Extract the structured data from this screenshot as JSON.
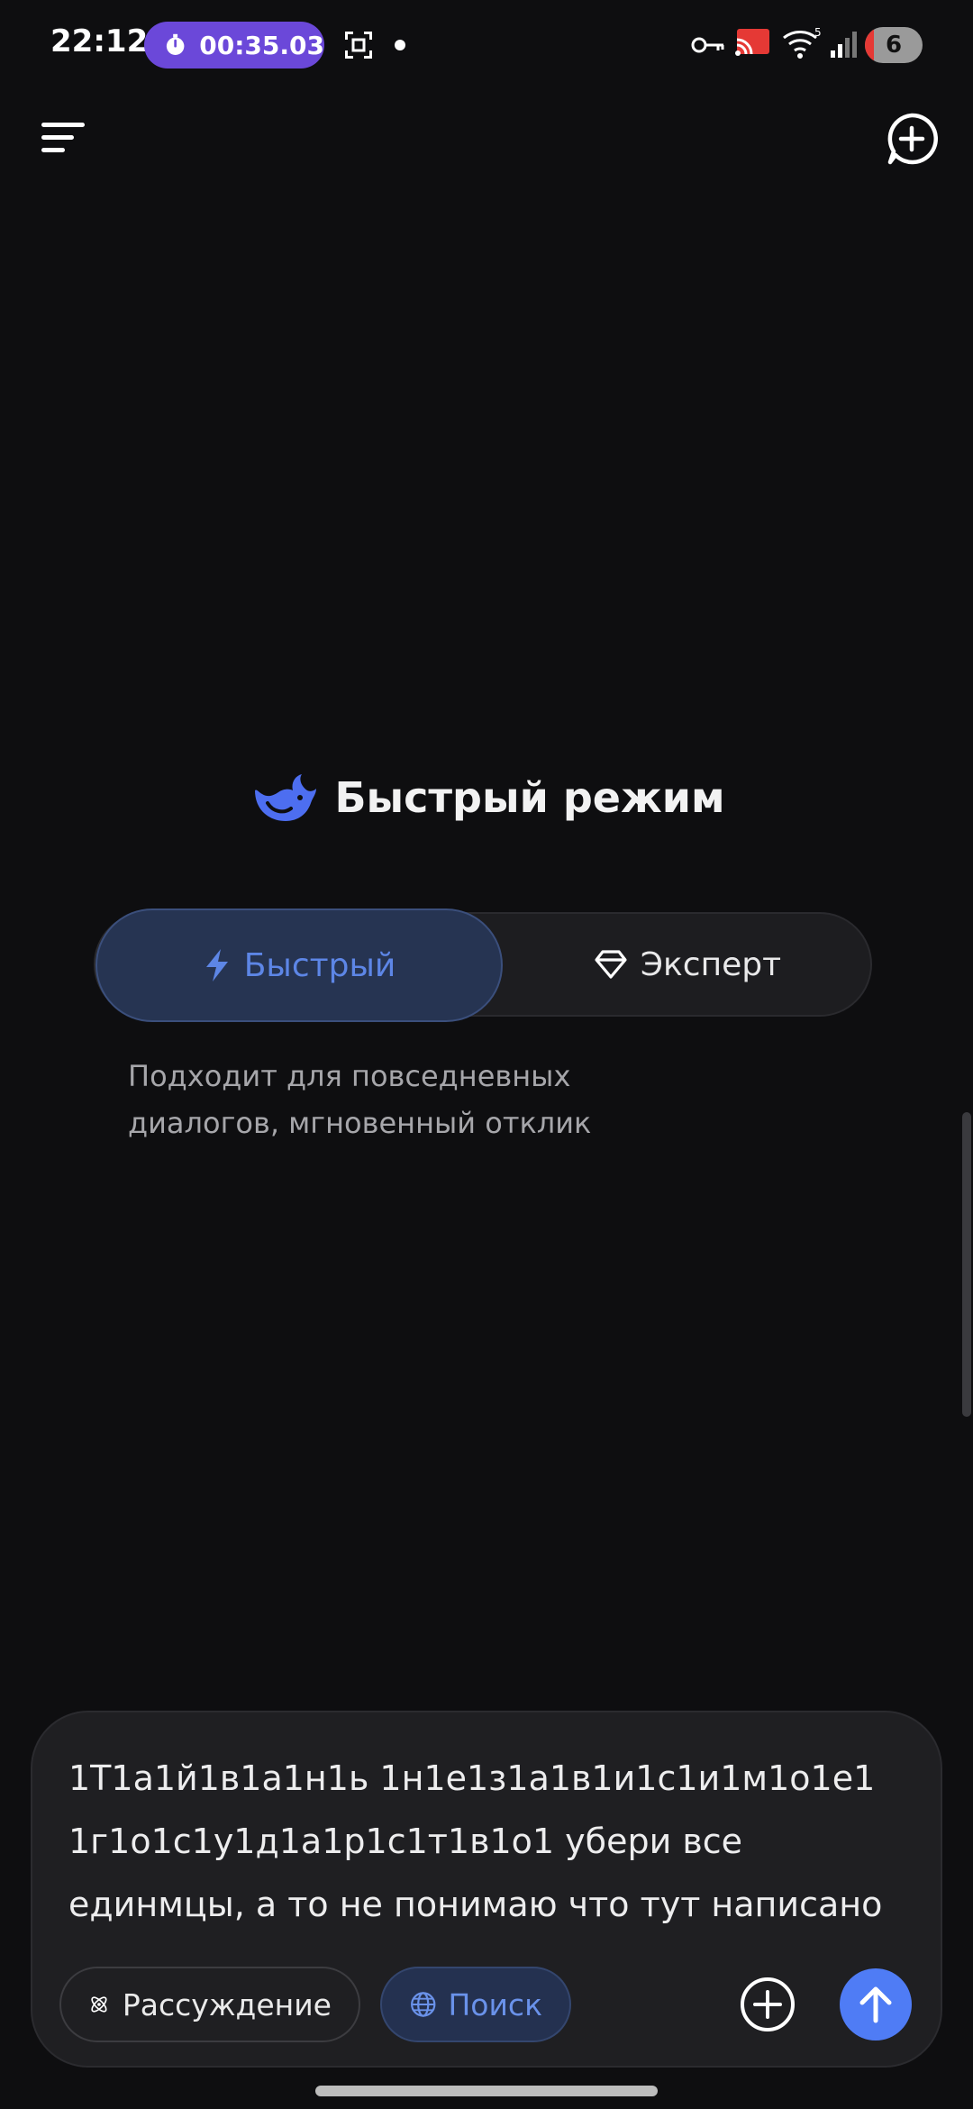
{
  "status_bar": {
    "time": "22:12",
    "timer": "00:35.03",
    "battery_level": "6",
    "icons": [
      "stopwatch-icon",
      "screenshot-icon",
      "dot-icon",
      "key-icon",
      "cast-icon",
      "wifi-icon",
      "signal-icon",
      "battery-icon"
    ]
  },
  "header": {
    "menu_icon": "menu-icon",
    "new_chat_icon": "new-chat-icon"
  },
  "mode": {
    "title": "Быстрый режим",
    "logo": "whale-logo-icon",
    "options": [
      {
        "label": "Быстрый",
        "icon": "lightning-icon",
        "selected": true
      },
      {
        "label": "Эксперт",
        "icon": "diamond-icon",
        "selected": false
      }
    ],
    "description": "Подходит для повседневных диалогов, мгновенный отклик"
  },
  "composer": {
    "text": "1Т1а1й1в1а1н1ь 1н1е1з1а1в1и1с1и1м1о1е1 1г1о1с1у1д1а1р1с1т1в1о1 убери все единмцы, а то не понимаю что тут написано",
    "chips": {
      "reasoning": "Рассуждение",
      "search": "Поиск"
    }
  },
  "colors": {
    "background": "#0e0e10",
    "accent": "#4f7cf5",
    "accent_text": "#5d86e6",
    "timer_pill": "#6b48d9"
  }
}
